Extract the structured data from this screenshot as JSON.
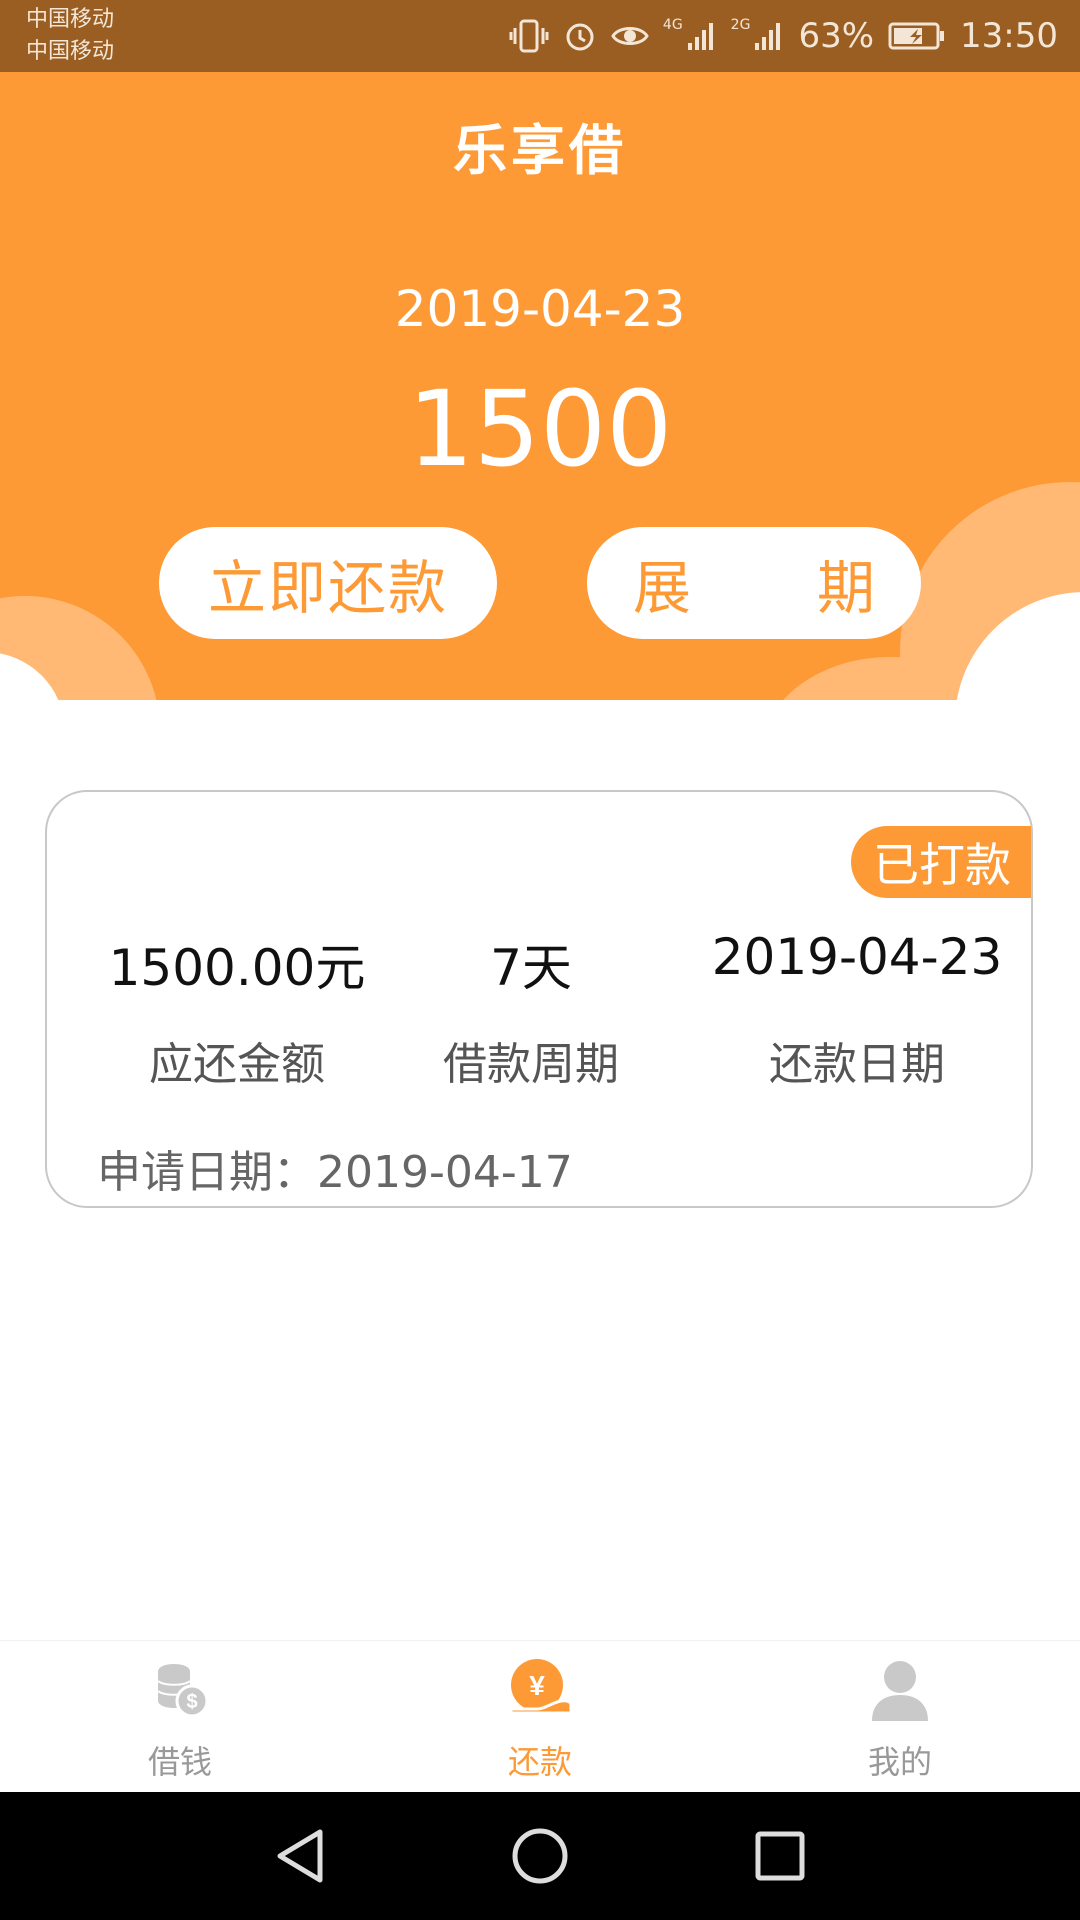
{
  "status_bar": {
    "carrier_1": "中国移动",
    "carrier_2": "中国移动",
    "signal_1_label": "4G",
    "signal_2_label": "2G",
    "battery": "63%",
    "time": "13:50"
  },
  "header": {
    "app_title": "乐享借",
    "due_date": "2019-04-23",
    "due_amount": "1500",
    "repay_now_label": "立即还款",
    "extend_label_1": "展",
    "extend_label_2": "期"
  },
  "loan_card": {
    "status_badge": "已打款",
    "amount_due_value": "1500.00元",
    "amount_due_label": "应还金额",
    "period_value": "7天",
    "period_label": "借款周期",
    "repay_date_value": "2019-04-23",
    "repay_date_label": "还款日期",
    "apply_date_label": "申请日期：",
    "apply_date_value": "2019-04-17"
  },
  "tabbar": {
    "borrow": "借钱",
    "repay": "还款",
    "mine": "我的"
  },
  "icons": {
    "borrow": "coins-icon",
    "repay": "yen-hand-icon",
    "mine": "user-icon",
    "back": "back-triangle-icon",
    "home": "home-circle-icon",
    "recents": "recents-square-icon"
  },
  "colors": {
    "accent": "#fd9a36",
    "status_bar": "#9a5e22"
  }
}
